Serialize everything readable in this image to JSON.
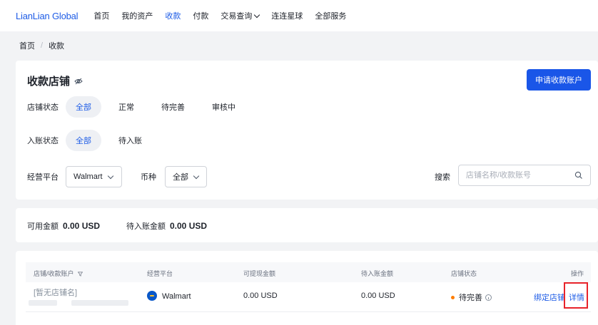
{
  "header": {
    "logo": "LianLian Global",
    "nav": [
      {
        "label": "首页",
        "active": false
      },
      {
        "label": "我的资产",
        "active": false
      },
      {
        "label": "收款",
        "active": true
      },
      {
        "label": "付款",
        "active": false
      },
      {
        "label": "交易查询",
        "active": false,
        "dropdown": true
      },
      {
        "label": "连连星球",
        "active": false
      },
      {
        "label": "全部服务",
        "active": false
      }
    ]
  },
  "breadcrumb": {
    "home": "首页",
    "separator": "/",
    "current": "收款"
  },
  "shops": {
    "title": "收款店铺",
    "apply_button": "申请收款账户",
    "status_filter": {
      "label": "店铺状态",
      "options": [
        "全部",
        "正常",
        "待完善",
        "审核中"
      ],
      "selected": 0
    },
    "posting_filter": {
      "label": "入账状态",
      "options": [
        "全部",
        "待入账"
      ],
      "selected": 0
    },
    "platform": {
      "label": "经营平台",
      "value": "Walmart"
    },
    "currency": {
      "label": "币种",
      "value": "全部"
    },
    "search": {
      "label": "搜索",
      "placeholder": "店铺名称/收款账号"
    }
  },
  "balance": {
    "available_label": "可用金额",
    "available_value": "0.00 USD",
    "pending_label": "待入账金额",
    "pending_value": "0.00 USD"
  },
  "table": {
    "headers": [
      "店铺/收款账户",
      "经营平台",
      "可提现金额",
      "待入账金额",
      "店铺状态",
      "操作"
    ],
    "rows": [
      {
        "shop_name": "[暂无店铺名]",
        "platform": "Walmart",
        "withdrawable": "0.00 USD",
        "pending": "0.00 USD",
        "status": "待完善",
        "actions": [
          "绑定店铺",
          "详情"
        ]
      }
    ]
  },
  "colors": {
    "accent": "#1e5ce6",
    "button": "#1a56e8",
    "status_pending": "#ff7d00",
    "highlight": "#e8232a"
  }
}
